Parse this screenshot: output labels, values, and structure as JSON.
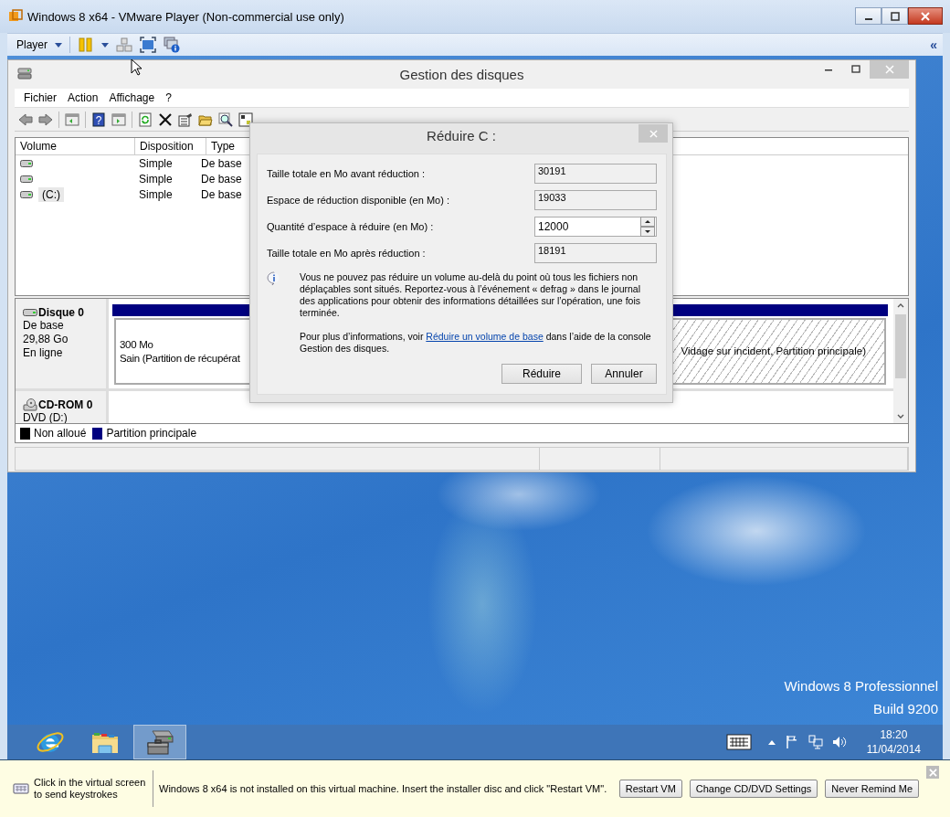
{
  "vm_window": {
    "title": "Windows 8 x64 - VMware Player (Non-commercial use only)",
    "toolbar": {
      "menu": "Player",
      "collapse": "«"
    }
  },
  "disk_management": {
    "title": "Gestion des disques",
    "menu": [
      "Fichier",
      "Action",
      "Affichage",
      "?"
    ],
    "help_button": "?",
    "volume_list": {
      "columns": [
        "Volume",
        "Disposition",
        "Type"
      ],
      "rows": [
        {
          "layout": "Simple",
          "type": "De base",
          "selected": false
        },
        {
          "layout": "Simple",
          "type": "De base",
          "selected": false
        },
        {
          "volume": "(C:)",
          "layout": "Simple",
          "type": "De base",
          "selected": true
        }
      ]
    },
    "disks": [
      {
        "kind": "disk",
        "name": "Disque 0",
        "lines": [
          "De base",
          "29,88 Go",
          "En ligne"
        ],
        "partitions": [
          {
            "kind": "plain",
            "color": "#000080",
            "size": "300 Mo",
            "status": "Sain (Partition de récupérat"
          },
          {
            "kind": "hatched",
            "color": "#000080",
            "status": "Vidage sur incident, Partition principale)"
          }
        ]
      },
      {
        "kind": "cdrom",
        "name": "CD-ROM 0",
        "lines": [
          "DVD (D:)"
        ]
      }
    ],
    "legend": [
      {
        "label": "Non alloué",
        "color": "#000000"
      },
      {
        "label": "Partition principale",
        "color": "#000080"
      }
    ]
  },
  "dialog": {
    "title": "Réduire C :",
    "fields": [
      {
        "kind": "readonly",
        "label": "Taille totale en Mo avant réduction :",
        "value": "30191"
      },
      {
        "kind": "readonly",
        "label": "Espace de réduction disponible (en Mo) :",
        "value": "19033"
      },
      {
        "kind": "spinner",
        "label": "Quantité d’espace à réduire (en Mo) :",
        "value": "12000"
      },
      {
        "kind": "readonly",
        "label": "Taille totale en Mo après réduction :",
        "value": "18191"
      }
    ],
    "info": "Vous ne pouvez pas réduire un volume au-delà du point où tous les fichiers non déplaçables sont situés. Reportez-vous à l’événement « defrag » dans le journal des applications pour obtenir des informations détaillées sur l’opération, une fois terminée.",
    "help": {
      "before": "Pour plus d’informations, voir",
      "link": "Réduire un volume de base",
      "after": "dans l’aide de la console Gestion des disques."
    },
    "buttons": [
      "Réduire",
      "Annuler"
    ]
  },
  "desktop": {
    "watermark": [
      "Windows 8 Professionnel",
      "Build 9200"
    ]
  },
  "taskbar": {
    "apps": [
      {
        "kind": "browser",
        "selected": false
      },
      {
        "kind": "explorer",
        "selected": false
      },
      {
        "kind": "disk-management",
        "selected": true
      }
    ],
    "clock": {
      "time": "18:20",
      "date": "11/04/2014"
    }
  },
  "notification": {
    "hint": "Click in the virtual screen to send keystrokes",
    "message": "Windows 8 x64 is not installed on this virtual machine. Insert the installer disc and click \"Restart VM\".",
    "buttons": [
      "Restart VM",
      "Change CD/DVD Settings",
      "Never Remind Me"
    ]
  }
}
